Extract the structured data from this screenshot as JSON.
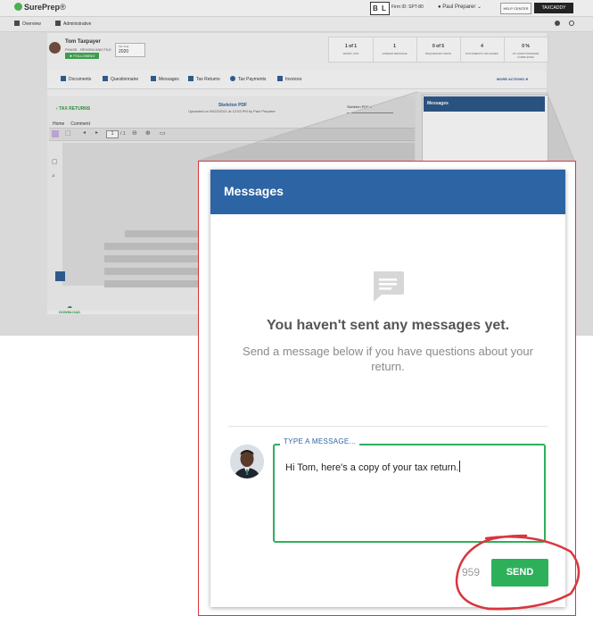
{
  "app": {
    "logo_brand": "SurePrep",
    "logo_suffix": "®",
    "bl_badge": "B L",
    "firm_id": "Firm ID: SPT-80",
    "user_name": "Paul Preparer",
    "help_center_label": "HELP CENTER",
    "taxcaddy_label": "TAXCADDY"
  },
  "nav": {
    "overview": "Overview",
    "administrative": "Administrative"
  },
  "taxpayer": {
    "name": "Tom Taxpayer",
    "phase": "PHASE - REVIEW AND FILE",
    "following": "FOLLOWING",
    "tax_year_label": "Tax Year",
    "tax_year": "2020"
  },
  "stats": [
    {
      "num": "1 of 1",
      "cap": "SMART LINK"
    },
    {
      "num": "1",
      "cap": "UNREAD MESSAGE"
    },
    {
      "num": "0 of 5",
      "cap": "REQUESTED ITEMS"
    },
    {
      "num": "4",
      "cap": "DOCUMENTS UPLOADED"
    },
    {
      "num": "0 %",
      "cap": "OF QUESTIONNAIRE COMPLETED"
    }
  ],
  "subnav": {
    "documents": "Documents",
    "questionnaire": "Questionnaire",
    "messages": "Messages",
    "tax_returns": "Tax Returns",
    "tax_payments": "Tax Payments",
    "invoices": "Invoices",
    "more_actions": "MORE ACTIONS"
  },
  "doc": {
    "back": "TAX RETURNS",
    "title": "Skeleton PDF",
    "subtitle": "Uploaded on 09/22/2021 at 12:03 PM by Paul Preparer",
    "select_value": "Skeleton PDF",
    "tab_home": "Home",
    "tab_comment": "Comment",
    "page_num": "1",
    "page_total": "/ 1",
    "download": "DOWNLOAD"
  },
  "mini_panel": {
    "title": "Messages"
  },
  "dialog": {
    "title": "Messages",
    "empty_title": "You haven't sent any messages yet.",
    "empty_sub": "Send a message below if you have questions about your return.",
    "input_label": "TYPE A MESSAGE...",
    "input_value": "Hi Tom, here's a copy of your tax return.",
    "char_count": "959",
    "send_label": "SEND"
  },
  "colors": {
    "header_blue": "#2d64a4",
    "send_green": "#2eb05a",
    "highlight_red": "#d9363e"
  },
  "icons": {
    "empty_state": "chat-bubble-icon"
  }
}
